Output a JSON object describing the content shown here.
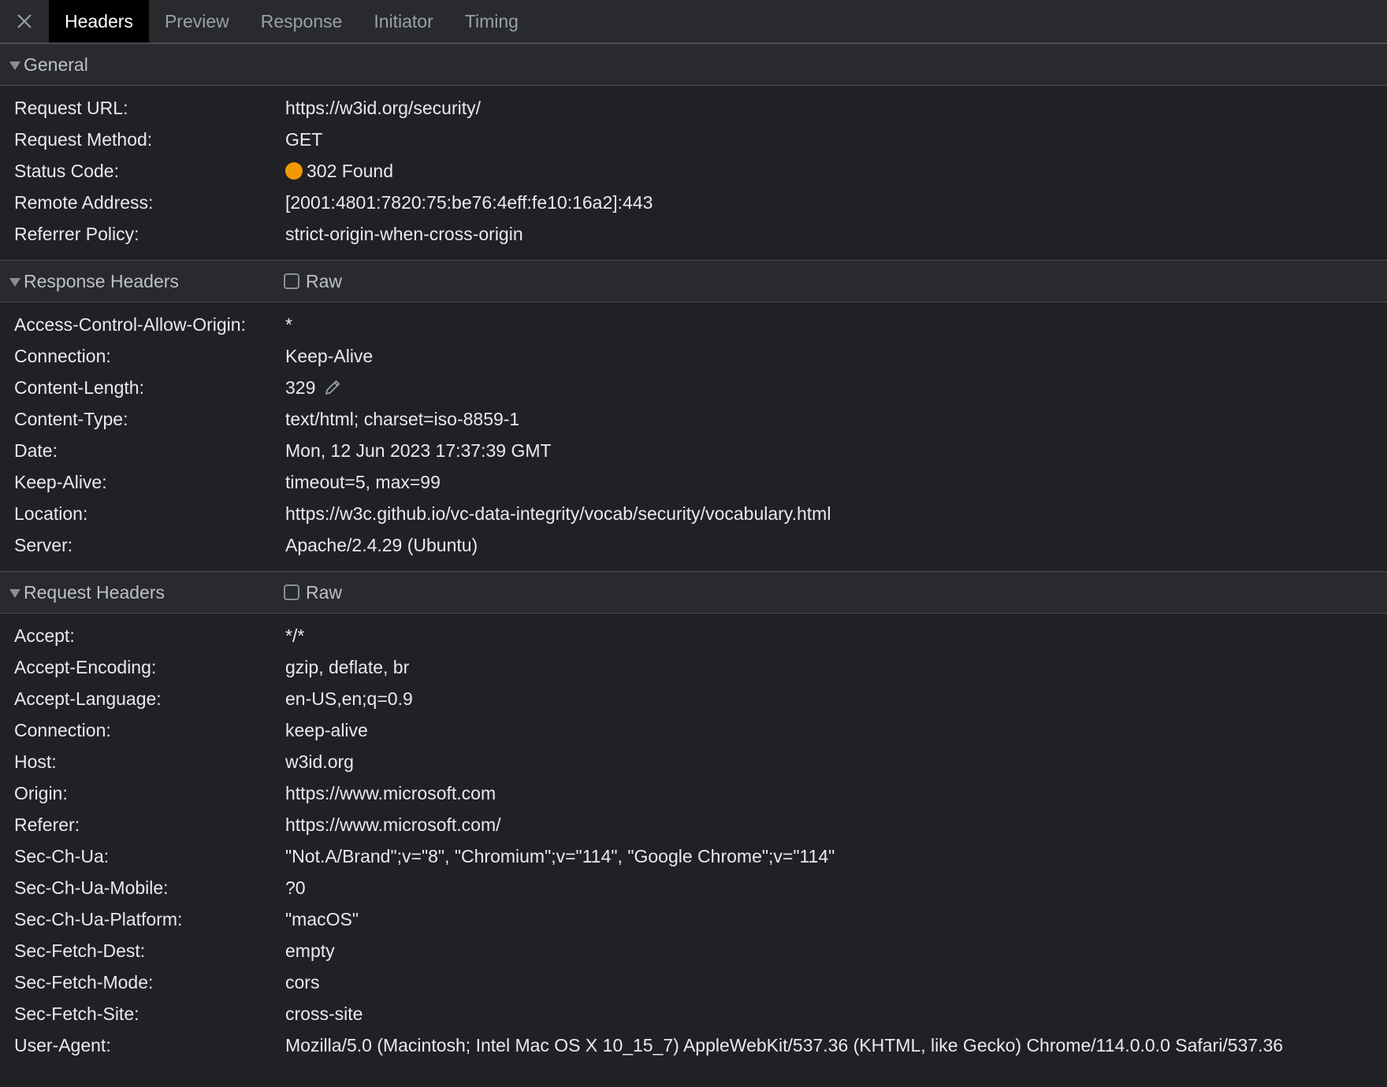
{
  "tabs": [
    {
      "label": "Headers",
      "active": true
    },
    {
      "label": "Preview",
      "active": false
    },
    {
      "label": "Response",
      "active": false
    },
    {
      "label": "Initiator",
      "active": false
    },
    {
      "label": "Timing",
      "active": false
    }
  ],
  "icons": {
    "close": "close-icon",
    "collapse": "triangle-down-icon",
    "status": "status-dot-icon",
    "edit": "pencil-icon"
  },
  "colors": {
    "status_warning": "#f29900",
    "active_tab_bg": "#000000",
    "panel_bg": "#202124"
  },
  "general": {
    "title": "General",
    "rows": [
      {
        "key": "Request URL:",
        "value": "https://w3id.org/security/"
      },
      {
        "key": "Request Method:",
        "value": "GET"
      },
      {
        "key": "Status Code:",
        "value": "302 Found"
      },
      {
        "key": "Remote Address:",
        "value": "[2001:4801:7820:75:be76:4eff:fe10:16a2]:443"
      },
      {
        "key": "Referrer Policy:",
        "value": "strict-origin-when-cross-origin"
      }
    ]
  },
  "response_headers": {
    "title": "Response Headers",
    "raw_label": "Raw",
    "raw_checked": false,
    "rows": [
      {
        "key": "Access-Control-Allow-Origin:",
        "value": "*"
      },
      {
        "key": "Connection:",
        "value": "Keep-Alive"
      },
      {
        "key": "Content-Length:",
        "value": "329"
      },
      {
        "key": "Content-Type:",
        "value": "text/html; charset=iso-8859-1"
      },
      {
        "key": "Date:",
        "value": "Mon, 12 Jun 2023 17:37:39 GMT"
      },
      {
        "key": "Keep-Alive:",
        "value": "timeout=5, max=99"
      },
      {
        "key": "Location:",
        "value": "https://w3c.github.io/vc-data-integrity/vocab/security/vocabulary.html"
      },
      {
        "key": "Server:",
        "value": "Apache/2.4.29 (Ubuntu)"
      }
    ]
  },
  "request_headers": {
    "title": "Request Headers",
    "raw_label": "Raw",
    "raw_checked": false,
    "rows": [
      {
        "key": "Accept:",
        "value": "*/*"
      },
      {
        "key": "Accept-Encoding:",
        "value": "gzip, deflate, br"
      },
      {
        "key": "Accept-Language:",
        "value": "en-US,en;q=0.9"
      },
      {
        "key": "Connection:",
        "value": "keep-alive"
      },
      {
        "key": "Host:",
        "value": "w3id.org"
      },
      {
        "key": "Origin:",
        "value": "https://www.microsoft.com"
      },
      {
        "key": "Referer:",
        "value": "https://www.microsoft.com/"
      },
      {
        "key": "Sec-Ch-Ua:",
        "value": "\"Not.A/Brand\";v=\"8\", \"Chromium\";v=\"114\", \"Google Chrome\";v=\"114\""
      },
      {
        "key": "Sec-Ch-Ua-Mobile:",
        "value": "?0"
      },
      {
        "key": "Sec-Ch-Ua-Platform:",
        "value": "\"macOS\""
      },
      {
        "key": "Sec-Fetch-Dest:",
        "value": "empty"
      },
      {
        "key": "Sec-Fetch-Mode:",
        "value": "cors"
      },
      {
        "key": "Sec-Fetch-Site:",
        "value": "cross-site"
      },
      {
        "key": "User-Agent:",
        "value": "Mozilla/5.0 (Macintosh; Intel Mac OS X 10_15_7) AppleWebKit/537.36 (KHTML, like Gecko) Chrome/114.0.0.0 Safari/537.36"
      }
    ]
  }
}
